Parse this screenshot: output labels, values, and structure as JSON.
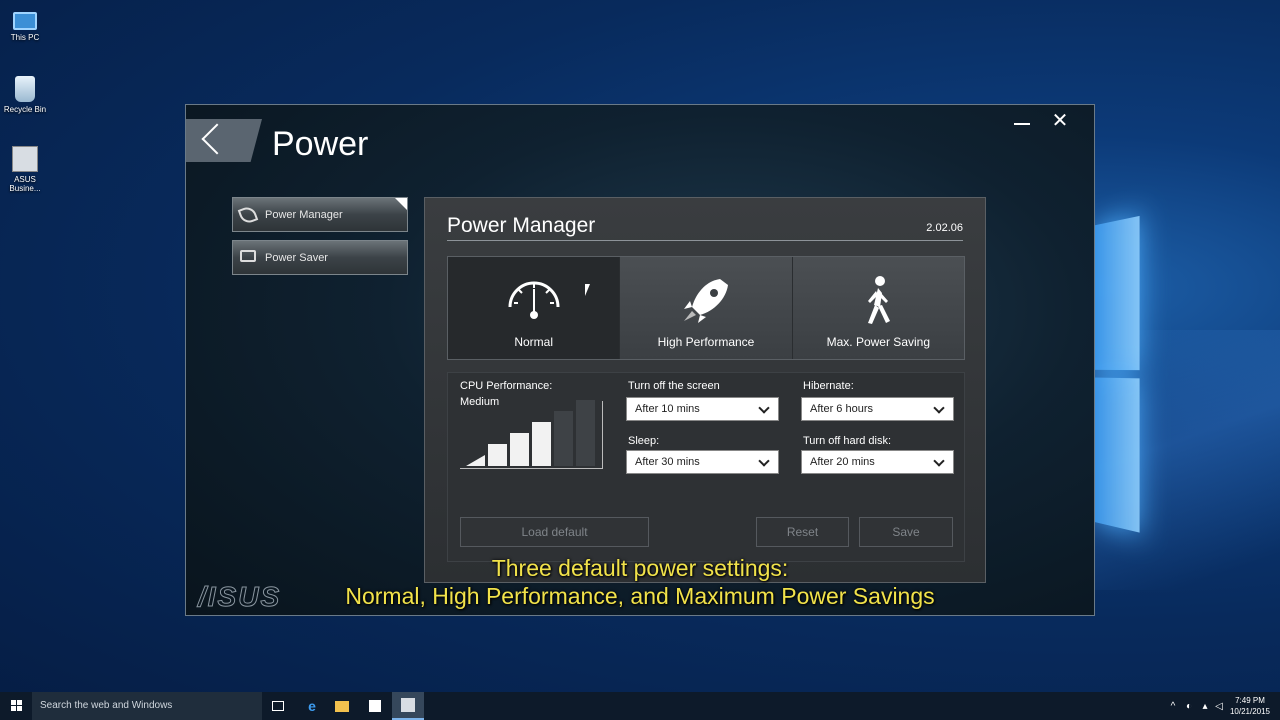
{
  "desktop": {
    "icons": [
      {
        "label": "This PC"
      },
      {
        "label": "Recycle Bin"
      },
      {
        "label": "ASUS Busine..."
      }
    ]
  },
  "window": {
    "title": "Power",
    "sidebar": {
      "items": [
        {
          "label": "Power Manager",
          "icon": "leaf-icon",
          "active": true
        },
        {
          "label": "Power Saver",
          "icon": "monitor-moon-icon",
          "active": false
        }
      ]
    },
    "brand": "/ISUS",
    "panel": {
      "title": "Power Manager",
      "version": "2.02.06",
      "modes": [
        {
          "label": "Normal",
          "icon": "speedometer-icon",
          "selected": true
        },
        {
          "label": "High Performance",
          "icon": "rocket-icon",
          "selected": false
        },
        {
          "label": "Max. Power Saving",
          "icon": "walking-person-icon",
          "selected": false
        }
      ],
      "cpu": {
        "label": "CPU Performance:",
        "value": "Medium",
        "level_filled": 4,
        "level_total": 6
      },
      "settings": {
        "screen_off": {
          "label": "Turn off the screen",
          "value": "After 10 mins"
        },
        "hibernate": {
          "label": "Hibernate:",
          "value": "After 6 hours"
        },
        "sleep": {
          "label": "Sleep:",
          "value": "After 30 mins"
        },
        "hdd_off": {
          "label": "Turn off hard disk:",
          "value": "After 20 mins"
        }
      },
      "buttons": {
        "load_default": "Load default",
        "reset": "Reset",
        "save": "Save"
      }
    }
  },
  "caption": {
    "line1": "Three default power settings:",
    "line2": "Normal, High Performance, and Maximum Power Savings"
  },
  "taskbar": {
    "search_placeholder": "Search the web and Windows",
    "time": "7:49 PM",
    "date": "10/21/2015"
  },
  "colors": {
    "caption": "#f1e24a",
    "desktop_bg": "#0c3a78",
    "panel_bg": "#3a3d40"
  }
}
